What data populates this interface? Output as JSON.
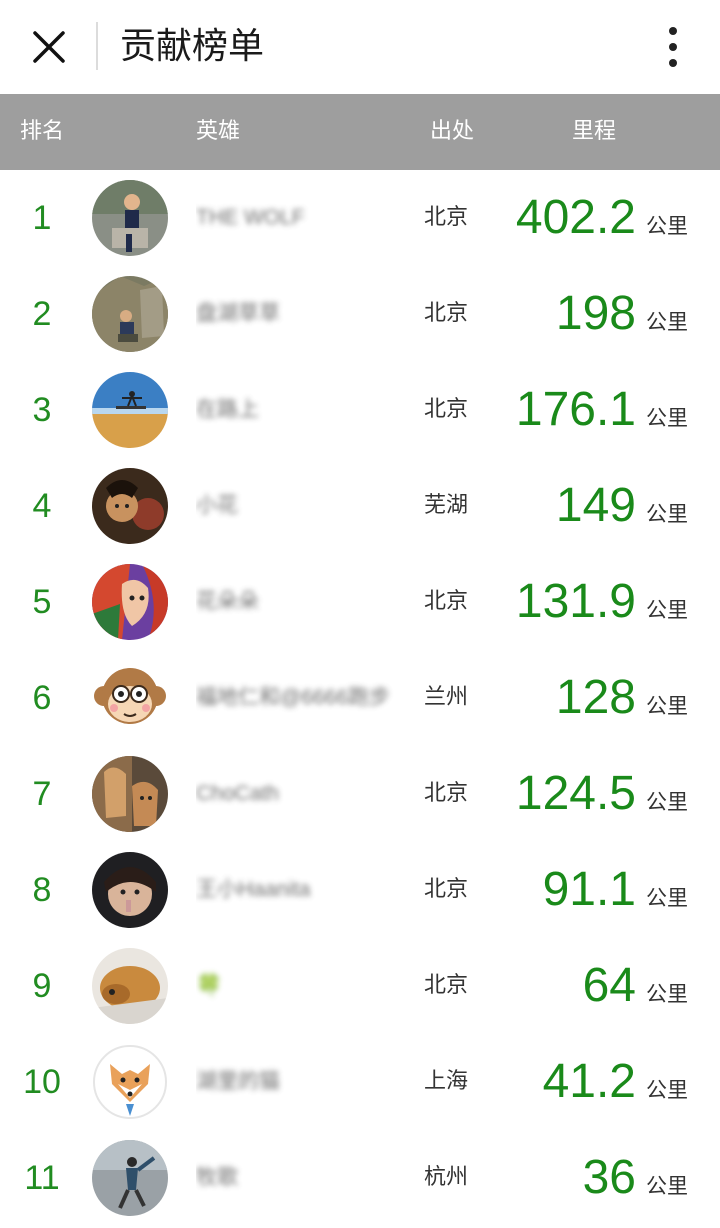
{
  "header": {
    "title": "贡献榜单",
    "close_icon": "close-icon",
    "more_icon": "more-vertical-icon"
  },
  "table": {
    "columns": [
      "排名",
      "英雄",
      "出处",
      "里程"
    ],
    "unit": "公里",
    "rows": [
      {
        "rank": "1",
        "name": "THE WOLF",
        "city": "北京",
        "distance": "402.2",
        "avatar": "photo-boy"
      },
      {
        "rank": "2",
        "name": "盘湖草草",
        "city": "北京",
        "distance": "198",
        "avatar": "photo-rocks"
      },
      {
        "rank": "3",
        "name": "在路上",
        "city": "北京",
        "distance": "176.1",
        "avatar": "photo-beach"
      },
      {
        "rank": "4",
        "name": "小花",
        "city": "芜湖",
        "distance": "149",
        "avatar": "photo-doll"
      },
      {
        "rank": "5",
        "name": "花朵朵",
        "city": "北京",
        "distance": "131.9",
        "avatar": "painting-woman"
      },
      {
        "rank": "6",
        "name": "福地仁和@6666跑步",
        "city": "兰州",
        "distance": "128",
        "avatar": "monkey-cartoon"
      },
      {
        "rank": "7",
        "name": "ChoCath",
        "city": "北京",
        "distance": "124.5",
        "avatar": "photo-cats"
      },
      {
        "rank": "8",
        "name": "王小Haanita",
        "city": "北京",
        "distance": "91.1",
        "avatar": "photo-girl"
      },
      {
        "rank": "9",
        "name": "🍀",
        "city": "北京",
        "distance": "64",
        "avatar": "photo-dog"
      },
      {
        "rank": "10",
        "name": "湖里的猫",
        "city": "上海",
        "distance": "41.2",
        "avatar": "fox-illustration"
      },
      {
        "rank": "11",
        "name": "牧歌",
        "city": "杭州",
        "distance": "36",
        "avatar": "photo-runner"
      }
    ]
  },
  "colors": {
    "header_bg": "#9e9e9e",
    "accent_green": "#1a8a1a"
  }
}
